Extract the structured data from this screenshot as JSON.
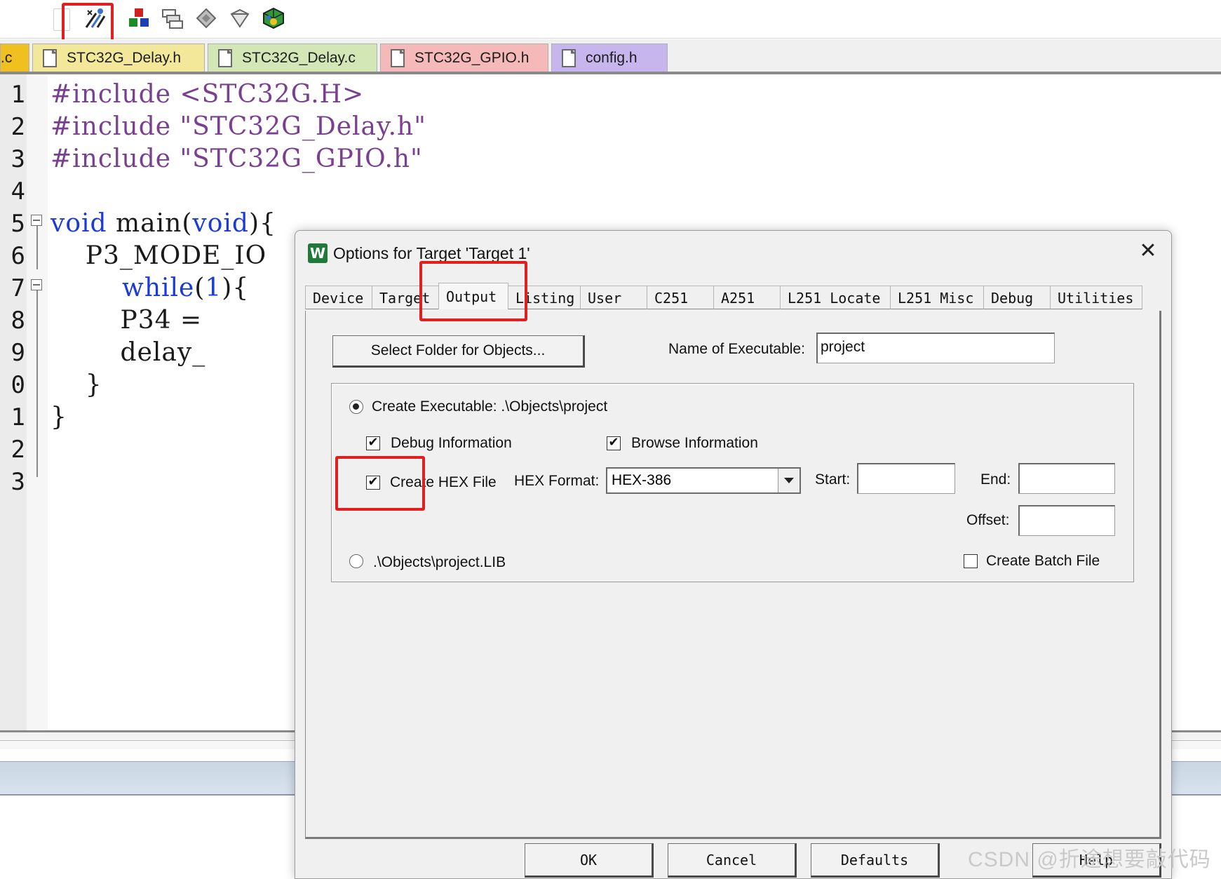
{
  "toolbar": {
    "icons": [
      "checkbox-icon",
      "wand-options-icon",
      "components-icon",
      "manage-icon",
      "diamond-icon",
      "pack-icon",
      "cube-icon"
    ]
  },
  "file_tabs": [
    {
      "label": ".c",
      "color": "#e8c000"
    },
    {
      "label": "STC32G_Delay.h",
      "color": "#f3e89a"
    },
    {
      "label": "STC32G_Delay.c",
      "color": "#d2e7b5"
    },
    {
      "label": "STC32G_GPIO.h",
      "color": "#f5b9b9"
    },
    {
      "label": "config.h",
      "color": "#c7b6ee"
    }
  ],
  "editor": {
    "line_numbers": [
      "1",
      "2",
      "3",
      "4",
      "5",
      "6",
      "7",
      "8",
      "9",
      "0",
      "1",
      "2",
      "3"
    ],
    "lines": [
      {
        "kw": "#include",
        "rest": " <STC32G.H>"
      },
      {
        "kw": "#include",
        "rest": " \"STC32G_Delay.h\""
      },
      {
        "kw": "#include",
        "rest": " \"STC32G_GPIO.h\""
      },
      {
        "kw": "",
        "rest": ""
      },
      {
        "kw": "void",
        "mid": " main(",
        "kw2": "void",
        "rest": "){"
      },
      {
        "kw": "",
        "rest": "    P3_MODE_IO"
      },
      {
        "kw": "while",
        "mid": "(",
        "num": "1",
        "rest": "){"
      },
      {
        "kw": "",
        "rest": "        P34 ="
      },
      {
        "kw": "",
        "rest": "        delay_"
      },
      {
        "kw": "",
        "rest": "    }"
      },
      {
        "kw": "",
        "rest": "}"
      }
    ]
  },
  "dialog": {
    "title": "Options for Target 'Target 1'",
    "icon_text": "W",
    "close_glyph": "✕",
    "tabs": [
      "Device",
      "Target",
      "Output",
      "Listing",
      "User",
      "C251",
      "A251",
      "L251 Locate",
      "L251 Misc",
      "Debug",
      "Utilities"
    ],
    "active_tab": "Output",
    "select_folder_label": "Select Folder for Objects...",
    "name_exec_label": "Name of Executable:",
    "name_exec_value": "project",
    "create_exec_label": "Create Executable:  .\\Objects\\project",
    "debug_info_label": "Debug Information",
    "debug_info_checked": true,
    "browse_info_label": "Browse Information",
    "browse_info_checked": true,
    "create_hex_label": "Create HEX File",
    "create_hex_checked": true,
    "hex_format_label": "HEX Format:",
    "hex_format_value": "HEX-386",
    "start_label": "Start:",
    "end_label": "End:",
    "offset_label": "Offset:",
    "lib_label": ".\\Objects\\project.LIB",
    "batch_label": "Create Batch File",
    "batch_checked": false,
    "ok_label": "OK",
    "cancel_label": "Cancel",
    "defaults_label": "Defaults",
    "help_label": "Help",
    "check_glyph": "✔"
  },
  "watermark": "CSDN @折途想要敲代码",
  "colors": {
    "highlight": "#e02020",
    "preproc": "#7a3f91",
    "keyword": "#1a3bd6"
  }
}
